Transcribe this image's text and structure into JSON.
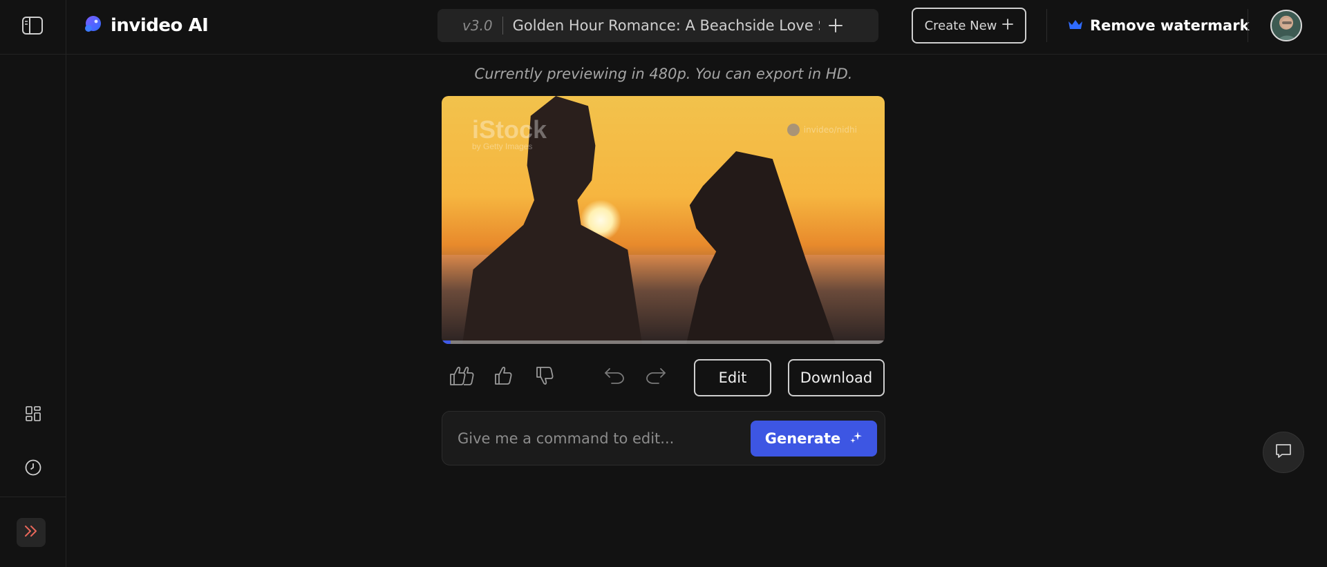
{
  "app": {
    "brand_name": "invideo AI",
    "accent_color": "#3d56e3"
  },
  "header": {
    "version": "v3.0",
    "project_title": "Golden Hour Romance: A Beachside Love Story",
    "add_icon": "plus-icon",
    "create_new_label": "Create New",
    "remove_watermark_label": "Remove watermark",
    "remove_watermark_icon": "crown-icon",
    "crown_color": "#2f6bff"
  },
  "sidebar": {
    "toggle_icon": "sidebar-panel-icon",
    "items": [
      {
        "name": "dashboard",
        "icon": "grid-icon"
      },
      {
        "name": "history",
        "icon": "clock-icon"
      }
    ],
    "expand_icon": "double-chevron-right-icon",
    "expand_color": "#e8675a"
  },
  "preview": {
    "note": "Currently previewing in 480p. You can export in HD.",
    "watermark_left": "iStock",
    "watermark_left_sub": "by Getty Images",
    "watermark_right": "invideo/nidhi",
    "progress": 0.02
  },
  "actions": {
    "edit_label": "Edit",
    "download_label": "Download"
  },
  "command": {
    "placeholder": "Give me a command to edit...",
    "generate_label": "Generate"
  }
}
